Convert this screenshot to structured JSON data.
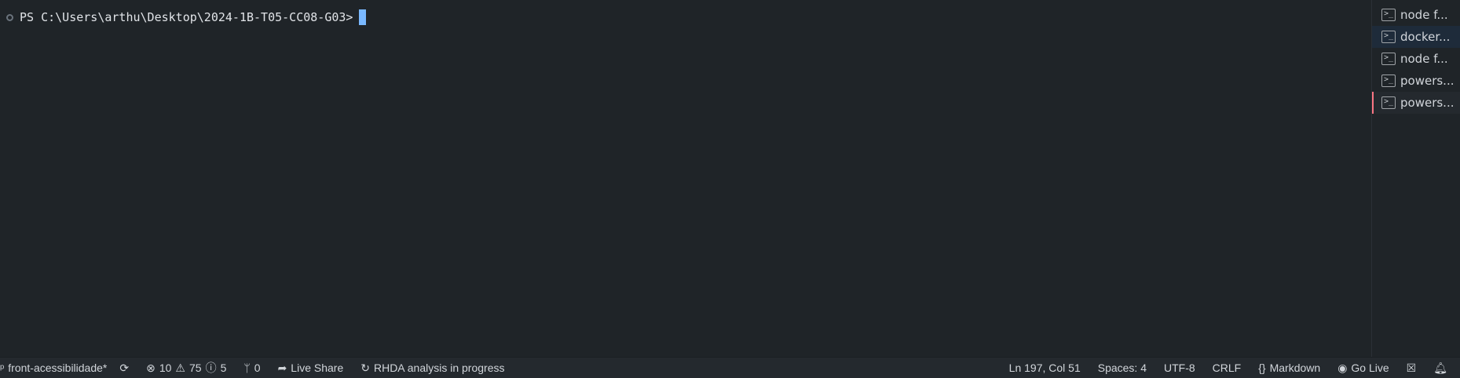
{
  "terminal": {
    "prompt": "PS C:\\Users\\arthu\\Desktop\\2024-1B-T05-CC08-G03>"
  },
  "terminal_tabs": [
    {
      "label": "node  f..."
    },
    {
      "label": "docker..."
    },
    {
      "label": "node  f..."
    },
    {
      "label": "powers..."
    },
    {
      "label": "powers..."
    }
  ],
  "status": {
    "branch": "front-acessibilidade*",
    "errors": "10",
    "warnings": "75",
    "infos": "5",
    "ports": "0",
    "live_share": "Live Share",
    "rhda": "RHDA analysis in progress",
    "position": "Ln 197, Col 51",
    "spaces": "Spaces: 4",
    "encoding": "UTF-8",
    "eol": "CRLF",
    "language": "Markdown",
    "go_live": "Go Live"
  }
}
